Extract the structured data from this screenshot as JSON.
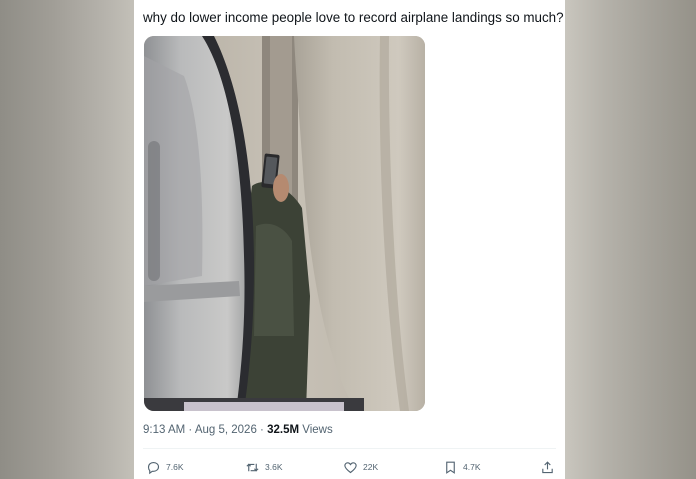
{
  "tweet": {
    "text": "why do lower income people love to record airplane landings so much?",
    "time": "9:13 AM",
    "separator": "·",
    "date": "Aug 5, 2026",
    "views_count": "32.5M",
    "views_label": "Views"
  },
  "actions": {
    "replies": "7.6K",
    "retweets": "3.6K",
    "likes": "22K",
    "bookmarks": "4.7K"
  },
  "colors": {
    "text": "#0f1419",
    "muted": "#536471"
  },
  "icons": [
    "reply-icon",
    "retweet-icon",
    "like-icon",
    "bookmark-icon",
    "share-icon"
  ]
}
